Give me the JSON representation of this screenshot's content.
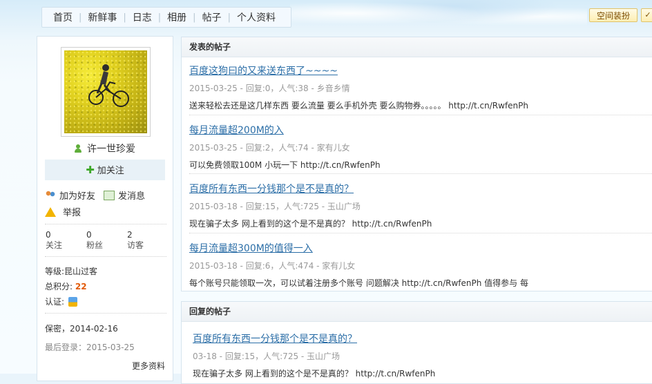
{
  "nav": {
    "items": [
      "首页",
      "新鲜事",
      "日志",
      "相册",
      "帖子",
      "个人资料"
    ],
    "decorate_label": "空间装扮",
    "decorate_extra": "✓"
  },
  "profile": {
    "username": "许一世珍爱",
    "follow_label": "加关注",
    "add_friend_label": "加为好友",
    "message_label": "发消息",
    "report_label": "举报",
    "stats": [
      {
        "value": "0",
        "label": "关注"
      },
      {
        "value": "0",
        "label": "粉丝"
      },
      {
        "value": "2",
        "label": "访客"
      }
    ],
    "level_label": "等级:",
    "level_value": "昆山过客",
    "points_label": "总积分:",
    "points_value": "22",
    "verify_label": "认证:",
    "privacy": "保密，2014-02-16",
    "last_login": "最后登录：2015-03-25",
    "more_label": "更多资料"
  },
  "posted": {
    "heading": "发表的帖子",
    "posts": [
      {
        "title": "百度这狗曰的又来送东西了~~~~",
        "meta": "2015-03-25 - 回复:0，人气:38 - 乡音乡情",
        "excerpt": "送来轻松去还是这几样东西  要么流量 要么手机外壳 要么购物券。。。。。 http://t.cn/RwfenPh"
      },
      {
        "title": "每月流量超200M的入",
        "meta": "2015-03-25 - 回复:2，人气:74 - 家有儿女",
        "excerpt": "可以免费领取100M 小玩一下 http://t.cn/RwfenPh"
      },
      {
        "title": "百度所有东西一分钱那个是不是真的？",
        "meta": "2015-03-18 - 回复:15，人气:725 - 玉山广场",
        "excerpt": "现在骗子太多  网上看到的这个是不是真的？ http://t.cn/RwfenPh"
      },
      {
        "title": "每月流量超300M的值得一入",
        "meta": "2015-03-18 - 回复:6，人气:474 - 家有儿女",
        "excerpt": "每个账号只能领取一次，可以试着注册多个账号 问题解决 http://t.cn/RwfenPh  值得参与 每"
      }
    ]
  },
  "replied": {
    "heading": "回复的帖子",
    "posts": [
      {
        "title": "百度所有东西一分钱那个是不是真的？",
        "meta": "03-18 - 回复:15，人气:725 - 玉山广场",
        "excerpt": "现在骗子太多  网上看到的这个是不是真的？ http://t.cn/RwfenPh"
      }
    ]
  }
}
